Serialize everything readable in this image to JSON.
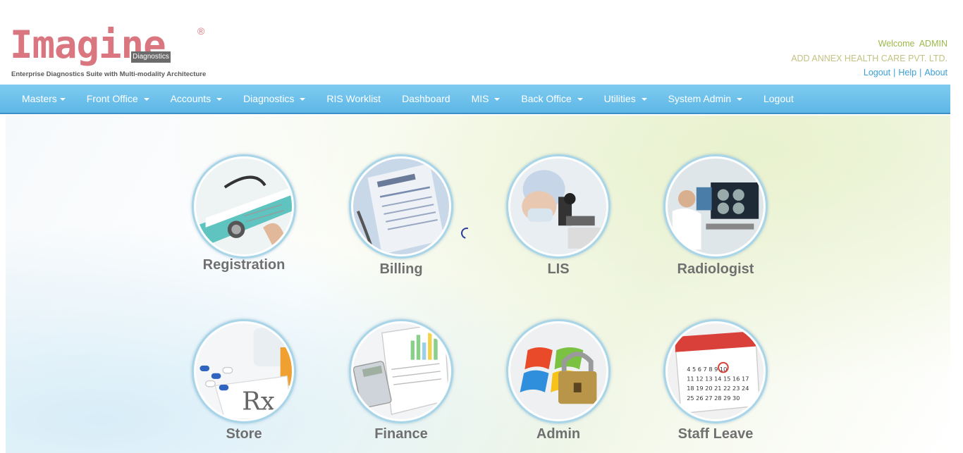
{
  "logo": {
    "word": "Imagine",
    "registered": "®",
    "badge": "Diagnostics",
    "tagline": "Enterprise Diagnostics Suite with Multi-modality Architecture"
  },
  "user": {
    "welcome": "Welcome  ADMIN",
    "company": "ADD ANNEX HEALTH CARE PVT. LTD.",
    "logout": "Logout",
    "help": "Help",
    "about": "About",
    "separator": "|"
  },
  "nav": {
    "items": [
      {
        "label": "Masters",
        "dropdown": true
      },
      {
        "label": "Front Office",
        "dropdown": true
      },
      {
        "label": "Accounts",
        "dropdown": true
      },
      {
        "label": "Diagnostics",
        "dropdown": true
      },
      {
        "label": "RIS Worklist",
        "dropdown": false
      },
      {
        "label": "Dashboard",
        "dropdown": false
      },
      {
        "label": "MIS",
        "dropdown": true
      },
      {
        "label": "Back Office",
        "dropdown": true
      },
      {
        "label": "Utilities",
        "dropdown": true
      },
      {
        "label": "System Admin",
        "dropdown": true
      },
      {
        "label": "Logout",
        "dropdown": false
      }
    ]
  },
  "tiles": [
    {
      "label": "Registration",
      "icon": "stethoscope-form-icon"
    },
    {
      "label": "Billing",
      "icon": "medical-invoice-icon"
    },
    {
      "label": "LIS",
      "icon": "microscope-icon"
    },
    {
      "label": "Radiologist",
      "icon": "radiology-monitor-icon"
    },
    {
      "label": "Store",
      "icon": "pills-rx-icon"
    },
    {
      "label": "Finance",
      "icon": "calculator-charts-icon"
    },
    {
      "label": "Admin",
      "icon": "windows-padlock-icon"
    },
    {
      "label": "Staff Leave",
      "icon": "calendar-icon"
    }
  ],
  "colors": {
    "brand": "#d9767f",
    "nav": "#6cc1eb",
    "link": "#3a9fd6",
    "welcome": "#9db84a"
  }
}
